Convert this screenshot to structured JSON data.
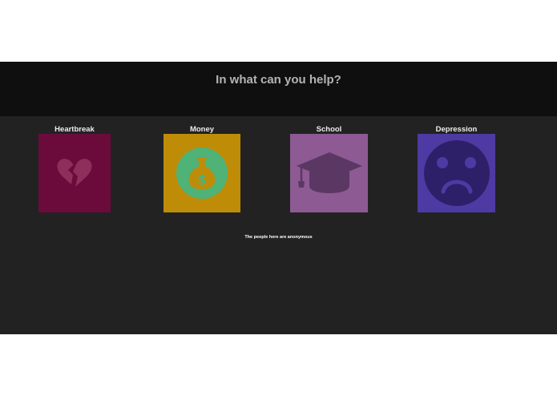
{
  "header": {
    "title": "In what can you help?"
  },
  "categories": [
    {
      "label": "Heartbreak",
      "icon": "broken-heart-icon",
      "bg": "#6b0b3c"
    },
    {
      "label": "Money",
      "icon": "money-bag-icon",
      "bg": "#bf8c08"
    },
    {
      "label": "School",
      "icon": "graduation-cap-icon",
      "bg": "#8d5a94"
    },
    {
      "label": "Depression",
      "icon": "sad-face-icon",
      "bg": "#4e3aa3"
    }
  ],
  "footer": {
    "note": "The people here are anonymous"
  }
}
